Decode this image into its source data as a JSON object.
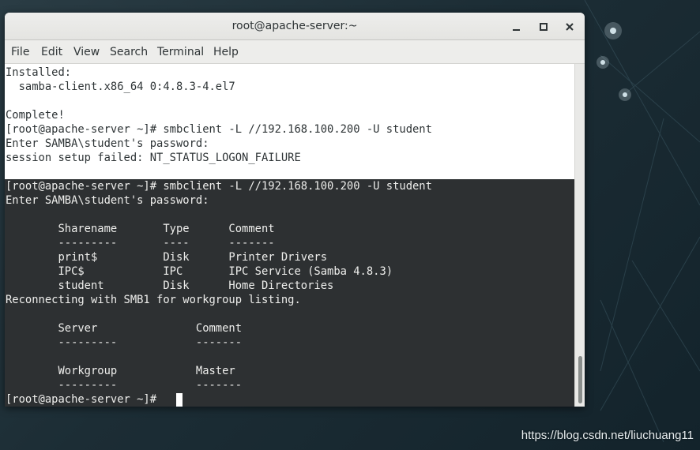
{
  "window": {
    "title": "root@apache-server:~"
  },
  "menu": {
    "file": "File",
    "edit": "Edit",
    "view": "View",
    "search": "Search",
    "terminal": "Terminal",
    "help": "Help"
  },
  "terminal": {
    "history_lines": [
      "Installed:",
      "  samba-client.x86_64 0:4.8.3-4.el7",
      "",
      "Complete!",
      "[root@apache-server ~]# smbclient -L //192.168.100.200 -U student",
      "Enter SAMBA\\student's password: ",
      "session setup failed: NT_STATUS_LOGON_FAILURE"
    ],
    "selected_lines": [
      "[root@apache-server ~]# smbclient -L //192.168.100.200 -U student",
      "Enter SAMBA\\student's password: ",
      "",
      "        Sharename       Type      Comment",
      "        ---------       ----      -------",
      "        print$          Disk      Printer Drivers",
      "        IPC$            IPC       IPC Service (Samba 4.8.3)",
      "        student         Disk      Home Directories",
      "Reconnecting with SMB1 for workgroup listing.",
      "",
      "        Server               Comment",
      "        ---------            -------",
      "",
      "        Workgroup            Master",
      "        ---------            -------",
      "[root@apache-server ~]# "
    ]
  },
  "desktop": {
    "watermark": "https://blog.csdn.net/liuchuang11"
  },
  "colors": {
    "terminal_background": "#ffffff",
    "terminal_text": "#2e3436",
    "selection_background": "#2d3032",
    "selection_text": "#eeeeec"
  }
}
